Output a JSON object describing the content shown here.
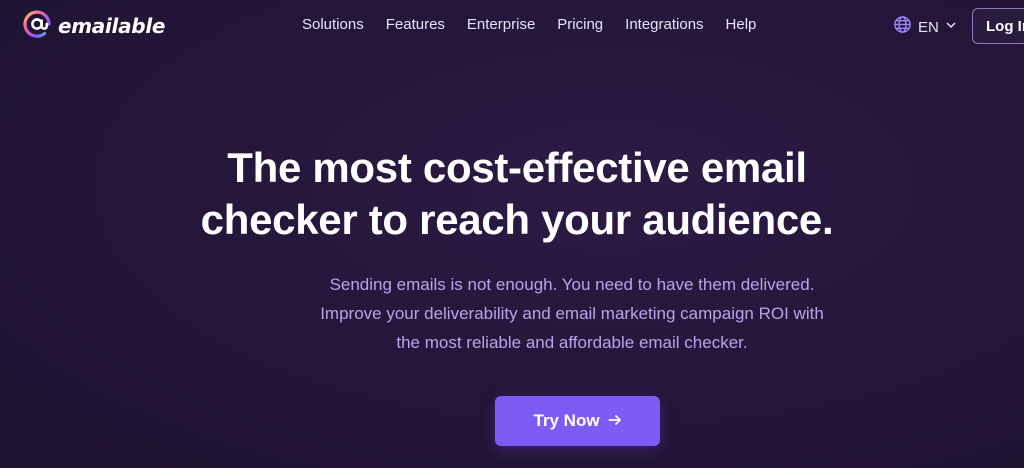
{
  "brand": {
    "name": "emailable"
  },
  "nav": {
    "items": [
      {
        "label": "Solutions"
      },
      {
        "label": "Features"
      },
      {
        "label": "Enterprise"
      },
      {
        "label": "Pricing"
      },
      {
        "label": "Integrations"
      },
      {
        "label": "Help"
      }
    ],
    "language": "EN",
    "login_label": "Log In"
  },
  "hero": {
    "title_line1": "The most cost-effective email",
    "title_line2": "checker to reach your audience.",
    "subtitle_line1": "Sending emails is not enough. You need to have them delivered.",
    "subtitle_line2": "Improve your deliverability and email marketing campaign ROI with",
    "subtitle_line3": "the most reliable and affordable email checker.",
    "cta_label": "Try Now"
  },
  "colors": {
    "background": "#241633",
    "accent": "#7c5cf5",
    "subtitle": "#b8a4ea"
  },
  "icons": {
    "logo": "at-sign-ring-icon",
    "language": "globe-icon",
    "dropdown": "chevron-down-icon",
    "cta": "arrow-right-icon"
  }
}
